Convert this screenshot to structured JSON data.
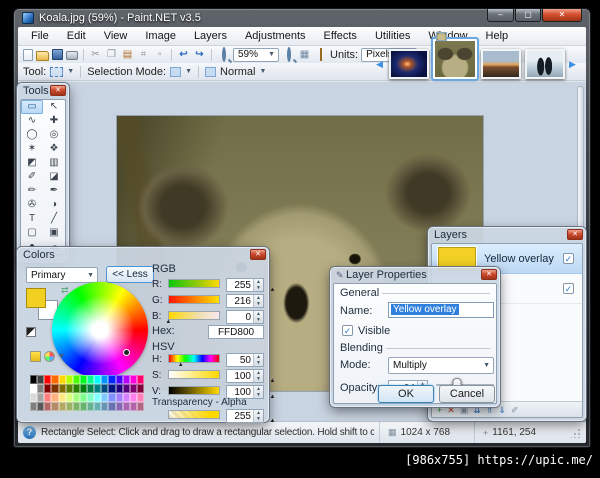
{
  "window": {
    "title": "Koala.jpg (59%) - Paint.NET v3.5"
  },
  "menu": {
    "items": [
      "File",
      "Edit",
      "View",
      "Image",
      "Layers",
      "Adjustments",
      "Effects",
      "Utilities",
      "Window",
      "Help"
    ]
  },
  "toolbar": {
    "zoom_value": "59%",
    "units_label": "Units:",
    "units_value": "Pixels"
  },
  "toolbar2": {
    "tool_label": "Tool:",
    "selection_mode_label": "Selection Mode:",
    "blend_mode_value": "Normal"
  },
  "thumbnails": {
    "items": [
      {
        "name": "jellyfish-thumbnail",
        "bg": "radial-gradient(55% 60% at 45% 50%, #f0a060 0 8%, #b05a2a 18%, #1c2a70 55%, #0a1040 100%)"
      },
      {
        "name": "koala-thumbnail",
        "selected": true,
        "bg": "radial-gradient(40% 35% at 26% 36%, #4a4430 0 45%, rgba(0,0,0,0) 52%), radial-gradient(40% 35% at 74% 36%, #4a4430 0 45%, rgba(0,0,0,0) 52%), radial-gradient(55% 60% at 50% 74%, #b8ae83 0 55%, rgba(0,0,0,0) 64%), linear-gradient(#7c7850, #6b683f)"
      },
      {
        "name": "sunset-thumbnail",
        "bg": "linear-gradient(#a8bccd 0 38%, #e2a55c 52%, #7a4e2e 62%, #32281f)"
      },
      {
        "name": "penguins-thumbnail",
        "bg": "radial-gradient(12% 42% at 38% 60%, #141c24 0 78%, rgba(0,0,0,0) 85%), radial-gradient(12% 42% at 60% 58%, #141c24 0 78%, rgba(0,0,0,0) 85%), linear-gradient(#e6eef4 0 35%, #b6c8d4 70%, #93a8b6)"
      }
    ]
  },
  "tools_window": {
    "title": "Tools",
    "tools": [
      {
        "name": "rectangle-select-icon",
        "glyph": "▭",
        "selected": true
      },
      {
        "name": "move-selected-pixels-icon",
        "glyph": "↖"
      },
      {
        "name": "lasso-select-icon",
        "glyph": "∿"
      },
      {
        "name": "move-selection-icon",
        "glyph": "✚"
      },
      {
        "name": "ellipse-select-icon",
        "glyph": "◯"
      },
      {
        "name": "zoom-tool-icon",
        "glyph": "◎"
      },
      {
        "name": "magic-wand-icon",
        "glyph": "✶"
      },
      {
        "name": "pan-tool-icon",
        "glyph": "❖"
      },
      {
        "name": "paint-bucket-icon",
        "glyph": "◩"
      },
      {
        "name": "gradient-tool-icon",
        "glyph": "▥"
      },
      {
        "name": "paintbrush-icon",
        "glyph": "✐"
      },
      {
        "name": "eraser-icon",
        "glyph": "◪"
      },
      {
        "name": "pencil-icon",
        "glyph": "✏"
      },
      {
        "name": "color-picker-icon",
        "glyph": "✒"
      },
      {
        "name": "clone-stamp-icon",
        "glyph": "✇"
      },
      {
        "name": "recolor-icon",
        "glyph": "◑"
      },
      {
        "name": "text-tool-icon",
        "glyph": "T"
      },
      {
        "name": "line-curve-icon",
        "glyph": "╱"
      },
      {
        "name": "rectangle-shape-icon",
        "glyph": "▢"
      },
      {
        "name": "rounded-rectangle-icon",
        "glyph": "▣"
      },
      {
        "name": "ellipse-shape-icon",
        "glyph": "●"
      },
      {
        "name": "freeform-shape-icon",
        "glyph": "☁"
      }
    ]
  },
  "colors_window": {
    "title": "Colors",
    "palette_dropdown_value": "Primary",
    "less_button_label": "<< Less",
    "rgb_label": "RGB",
    "rgb_rows": [
      {
        "label": "R:",
        "value": "255",
        "pos": "96%",
        "grad": "linear-gradient(to right,#0cc70c,#8ec90a 55%,#ffd800)"
      },
      {
        "label": "G:",
        "value": "216",
        "pos": "85%",
        "grad": "linear-gradient(to right,#ff1500,#ff8a00 55%,#ffe000)"
      },
      {
        "label": "B:",
        "value": "0",
        "pos": "3%",
        "grad": "linear-gradient(to right,#ffd800,#f2dfb0 60%,#f8e9ef)"
      }
    ],
    "hex_label": "Hex:",
    "hex_value": "FFD800",
    "hsv_label": "HSV",
    "hsv_rows": [
      {
        "label": "H:",
        "value": "50",
        "pos": "14%",
        "grad": "linear-gradient(to right,#f00,#ff0 17%,#0f0 33%,#0ff 50%,#00f 67%,#f0f 83%,#f00)"
      },
      {
        "label": "S:",
        "value": "100",
        "pos": "96%",
        "grad": "linear-gradient(to right,#ffffff,#ffd800)"
      },
      {
        "label": "V:",
        "value": "100",
        "pos": "96%",
        "grad": "linear-gradient(to right,#000000,#ffd800)"
      }
    ],
    "alpha_label": "Transparency - Alpha",
    "alpha_row": {
      "value": "255",
      "pos": "96%",
      "grad": "linear-gradient(to right, rgba(255,216,0,0), #ffd800 82%), repeating-linear-gradient(45deg, #e6dfc8 0 3px, #faf6ea 3px 6px)"
    },
    "palette": [
      "#000000",
      "#404040",
      "#ff0000",
      "#ff6a00",
      "#ffd800",
      "#b6ff00",
      "#4cff00",
      "#00ff21",
      "#00ff90",
      "#00ffff",
      "#0094ff",
      "#0026ff",
      "#4800ff",
      "#b200ff",
      "#ff00dc",
      "#ff006e",
      "#ffffff",
      "#808080",
      "#7f0000",
      "#7f3300",
      "#7f6a00",
      "#5b7f00",
      "#267f00",
      "#007f0e",
      "#007f46",
      "#007f7f",
      "#004a7f",
      "#00137f",
      "#21007f",
      "#57007f",
      "#7f006e",
      "#7f0037",
      "#d9d9d9",
      "#a6a6a6",
      "#ff7f7f",
      "#ffb27f",
      "#ffe97f",
      "#daff7f",
      "#a5ff7f",
      "#7fff8e",
      "#7fffc5",
      "#7fffff",
      "#7fc9ff",
      "#7f92ff",
      "#a17fff",
      "#d67fff",
      "#ff7fed",
      "#ff7fb6",
      "#7f7f7f",
      "#595959",
      "#b26666",
      "#b28c66",
      "#b2a866",
      "#9db266",
      "#7cb266",
      "#66b26f",
      "#66b295",
      "#66b2b2",
      "#6694b2",
      "#6672b2",
      "#8766b2",
      "#a866b2",
      "#b266a8",
      "#b26685"
    ]
  },
  "layer_properties": {
    "title": "Layer Properties",
    "general_label": "General",
    "name_label": "Name:",
    "name_value": "Yellow overlay",
    "visible_label": "Visible",
    "blending_label": "Blending",
    "mode_label": "Mode:",
    "mode_value": "Multiply",
    "opacity_label": "Opacity:",
    "opacity_value": "94",
    "opacity_pos": "37%",
    "ok_label": "OK",
    "cancel_label": "Cancel"
  },
  "layers_panel": {
    "title": "Layers",
    "layers": [
      {
        "label": "Yellow overlay",
        "selected": true,
        "checked": true
      },
      {
        "label": "",
        "bare": true,
        "checked": true
      }
    ],
    "buttons": [
      {
        "name": "add-layer-icon",
        "glyph": "+",
        "color": "#2e9e3c"
      },
      {
        "name": "delete-layer-icon",
        "glyph": "✕",
        "color": "#c23b22"
      },
      {
        "name": "duplicate-layer-icon",
        "glyph": "▣",
        "color": "#8a97a5"
      },
      {
        "name": "merge-down-icon",
        "glyph": "⇊",
        "color": "#2f6fbe"
      },
      {
        "name": "move-layer-up-icon",
        "glyph": "⇑",
        "color": "#2f6fbe"
      },
      {
        "name": "move-layer-down-icon",
        "glyph": "⇓",
        "color": "#2f6fbe"
      },
      {
        "name": "layer-properties-icon",
        "glyph": "✐",
        "color": "#8a97a5"
      }
    ]
  },
  "status_bar": {
    "message": "Rectangle Select: Click and drag to draw a rectangular selection. Hold shift to constrain to a square.",
    "image_size": "1024 x 768",
    "cursor_pos": "1161, 254"
  },
  "watermark": {
    "text": "[986x755] https://upic.me/"
  },
  "theme": {
    "accent_yellow": "#FFD800",
    "selection_blue": "#3399FF"
  }
}
